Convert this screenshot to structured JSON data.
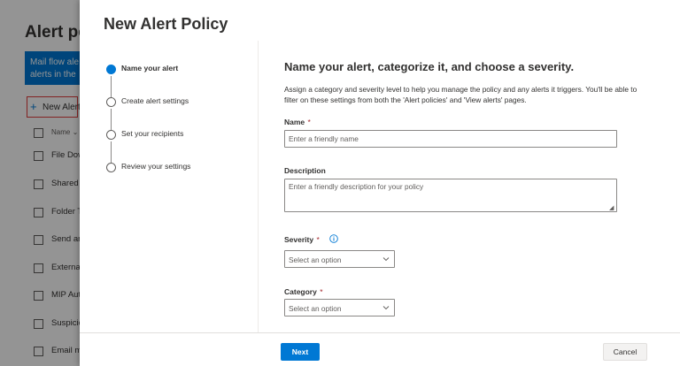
{
  "background": {
    "page_title": "Alert po",
    "banner_lines": [
      "Mail flow ale",
      "alerts in the"
    ],
    "new_alert_label": "New Alert",
    "column_header": "Name",
    "rows": [
      "File Dow",
      "Shared F",
      "Folder T",
      "Send an",
      "External",
      "MIP Aut",
      "Suspicio",
      "Email m"
    ]
  },
  "panel": {
    "title": "New Alert Policy",
    "steps": [
      {
        "label": "Name your alert",
        "state": "current"
      },
      {
        "label": "Create alert settings",
        "state": "pending"
      },
      {
        "label": "Set your recipients",
        "state": "pending"
      },
      {
        "label": "Review your settings",
        "state": "pending"
      }
    ],
    "form": {
      "heading": "Name your alert, categorize it, and choose a severity.",
      "description": "Assign a category and severity level to help you manage the policy and any alerts it triggers. You'll be able to filter on these settings from both the 'Alert policies' and 'View alerts' pages.",
      "name": {
        "label": "Name",
        "required_mark": "*",
        "value": "",
        "placeholder": "Enter a friendly name"
      },
      "description_field": {
        "label": "Description",
        "value": "",
        "placeholder": "Enter a friendly description for your policy"
      },
      "severity": {
        "label": "Severity",
        "required_mark": "*",
        "selected": "Select an option"
      },
      "category": {
        "label": "Category",
        "required_mark": "*",
        "selected": "Select an option"
      }
    },
    "buttons": {
      "next": "Next",
      "cancel": "Cancel"
    }
  },
  "colors": {
    "accent": "#0078d4",
    "required": "#a4262c",
    "highlight_border": "#e03c3c"
  }
}
